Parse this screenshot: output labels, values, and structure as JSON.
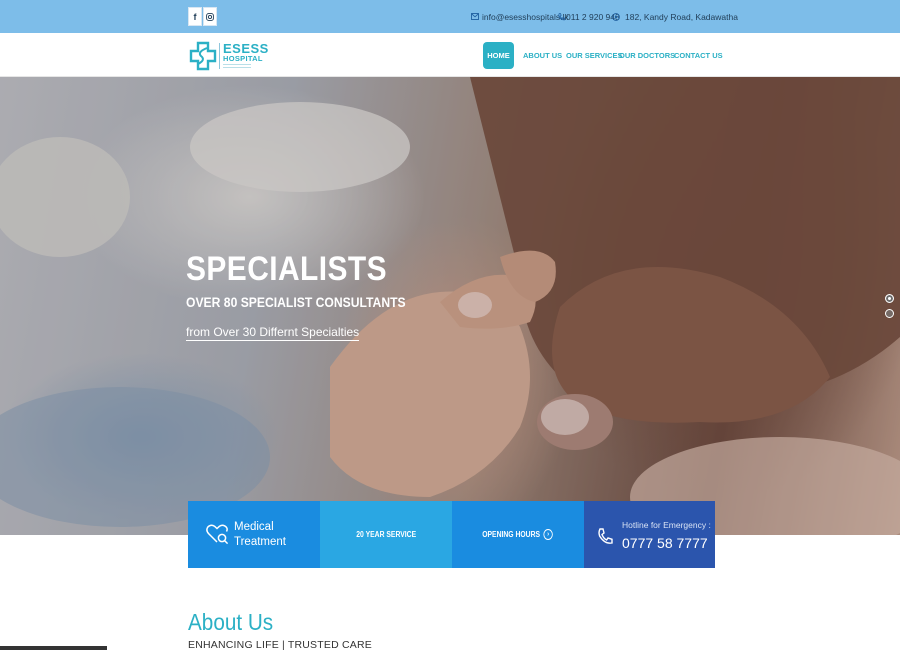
{
  "topbar": {
    "social": [
      {
        "icon": "facebook-icon",
        "glyph": "f"
      },
      {
        "icon": "instagram-icon",
        "glyph": ""
      }
    ],
    "email": "info@esesshospitals.lk",
    "phone": "011 2 920 943",
    "address": "182, Kandy Road, Kadawatha"
  },
  "logo": {
    "name": "ESESS",
    "sub": "HOSPITAL"
  },
  "nav": {
    "items": [
      "HOME",
      "ABOUT US",
      "OUR SERVICES",
      "OUR DOCTORS",
      "CONTACT US"
    ],
    "active": "HOME"
  },
  "hero": {
    "title": "SPECIALISTS",
    "subtitle": "OVER 80 SPECIALIST CONSULTANTS",
    "link": "from Over 30 Differnt Specialties",
    "slides": 2,
    "active_slide": 1
  },
  "features": {
    "medical": "Medical Treatment",
    "service": "20 YEAR SERVICE",
    "hours": "OPENING HOURS",
    "hotline_caption": "Hotline for Emergency :",
    "hotline_number": "0777 58 7777"
  },
  "about": {
    "title": "About Us",
    "subtitle": "ENHANCING LIFE | TRUSTED CARE"
  },
  "colors": {
    "topbar": "#7dbde9",
    "brand_teal": "#2bb0c5",
    "feature_blue": "#1a8ce0",
    "feature_light": "#2aa7e3",
    "feature_dark": "#2b55ad"
  }
}
